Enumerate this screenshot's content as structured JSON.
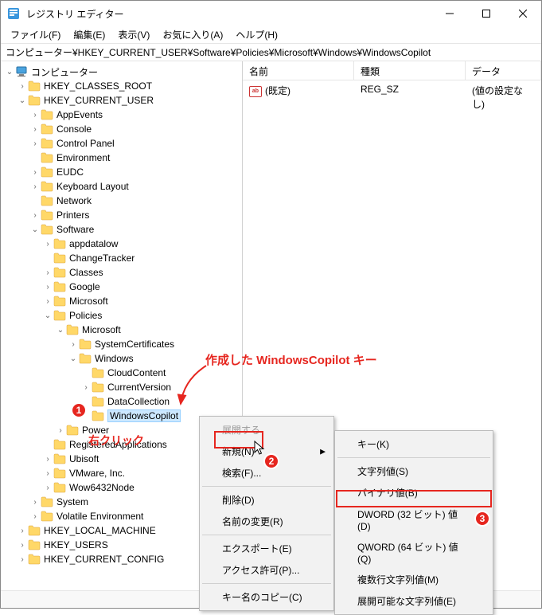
{
  "window": {
    "title": "レジストリ エディター"
  },
  "menu": {
    "file": "ファイル(F)",
    "edit": "編集(E)",
    "view": "表示(V)",
    "favorites": "お気に入り(A)",
    "help": "ヘルプ(H)"
  },
  "address": "コンピューター¥HKEY_CURRENT_USER¥Software¥Policies¥Microsoft¥Windows¥WindowsCopilot",
  "columns": {
    "name": "名前",
    "type": "種類",
    "data": "データ"
  },
  "rows": [
    {
      "name": "(既定)",
      "type": "REG_SZ",
      "data": "(値の設定なし)"
    }
  ],
  "tree": {
    "root": "コンピューター",
    "hkcr": "HKEY_CLASSES_ROOT",
    "hkcu": "HKEY_CURRENT_USER",
    "appevents": "AppEvents",
    "console": "Console",
    "controlpanel": "Control Panel",
    "environment": "Environment",
    "eudc": "EUDC",
    "keyboard": "Keyboard Layout",
    "network": "Network",
    "printers": "Printers",
    "software": "Software",
    "appdatalow": "appdatalow",
    "changetracker": "ChangeTracker",
    "classes": "Classes",
    "google": "Google",
    "microsoft": "Microsoft",
    "policies": "Policies",
    "policies_ms": "Microsoft",
    "syscerts": "SystemCertificates",
    "windows": "Windows",
    "cloudcontent": "CloudContent",
    "currentversion": "CurrentVersion",
    "datacollection": "DataCollection",
    "windowscopilot": "WindowsCopilot",
    "power": "Power",
    "regopts": "RegisteredApplications",
    "ubisoft": "Ubisoft",
    "vmware": "VMware, Inc.",
    "wow64": "Wow6432Node",
    "system": "System",
    "volatile": "Volatile Environment",
    "hklm": "HKEY_LOCAL_MACHINE",
    "hku": "HKEY_USERS",
    "hkcc": "HKEY_CURRENT_CONFIG"
  },
  "ctx1": {
    "expand": "展開する",
    "new": "新規(N)",
    "find": "検索(F)...",
    "delete": "削除(D)",
    "rename": "名前の変更(R)",
    "export": "エクスポート(E)",
    "perm": "アクセス許可(P)...",
    "copykey": "キー名のコピー(C)"
  },
  "ctx2": {
    "key": "キー(K)",
    "string": "文字列値(S)",
    "binary": "バイナリ値(B)",
    "dword": "DWORD (32 ビット) 値(D)",
    "qword": "QWORD (64 ビット) 値(Q)",
    "multi": "複数行文字列値(M)",
    "expand": "展開可能な文字列値(E)"
  },
  "annotations": {
    "created_key": "作成した WindowsCopilot キー",
    "right_click": "右クリック",
    "b1": "1",
    "b2": "2",
    "b3": "3"
  }
}
